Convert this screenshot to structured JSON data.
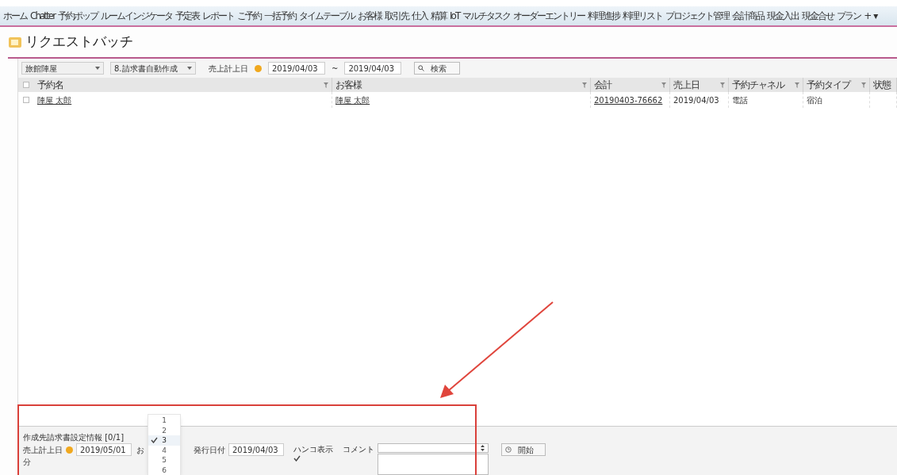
{
  "nav": {
    "items": [
      "ホーム",
      "Chatter",
      "予約ポップ",
      "ルームインジケータ",
      "予定表",
      "レポート",
      "ご予約",
      "一括予約",
      "タイムテーブル",
      "お客様",
      "取引先",
      "仕入",
      "精算",
      "IoT",
      "マルチタスク",
      "オーダーエントリー",
      "料理進捗",
      "料理リスト",
      "プロジェクト管理",
      "会計商品",
      "現金入出",
      "現金合せ",
      "プラン",
      "+",
      "▾"
    ]
  },
  "page": {
    "title": "リクエストバッチ"
  },
  "filters": {
    "store": "旅館陣屋",
    "mode": "8.請求書自動作成",
    "date_label": "売上計上日",
    "date_from": "2019/04/03",
    "separator": "~",
    "date_to": "2019/04/03",
    "search_button": "検索"
  },
  "table": {
    "header_checked": false,
    "columns": [
      "予約名",
      "お客様",
      "会計",
      "売上日",
      "予約チャネル",
      "予約タイプ",
      "状態"
    ],
    "rows": [
      {
        "checked": false,
        "cells": [
          "陣屋 太郎",
          "陣屋 太郎",
          "20190403-76662",
          "2019/04/03",
          "電話",
          "宿泊",
          ""
        ]
      }
    ]
  },
  "settings": {
    "title": "作成先請求書設定情報 [0/1]",
    "date_label": "売上計上日",
    "date_value": "2019/05/01",
    "partial_label": "お",
    "unit": "分",
    "issue_label": "発行日付",
    "issue_value": "2019/04/03",
    "stamp_label": "ハンコ表示",
    "stamp_checked": true,
    "comment_label": "コメント",
    "start_button": "開始"
  },
  "dropdown": {
    "options": [
      {
        "label": "1",
        "selected": false
      },
      {
        "label": "2",
        "selected": false
      },
      {
        "label": "3",
        "selected": true
      },
      {
        "label": "4",
        "selected": false
      },
      {
        "label": "5",
        "selected": false
      },
      {
        "label": "6",
        "selected": false
      }
    ]
  }
}
